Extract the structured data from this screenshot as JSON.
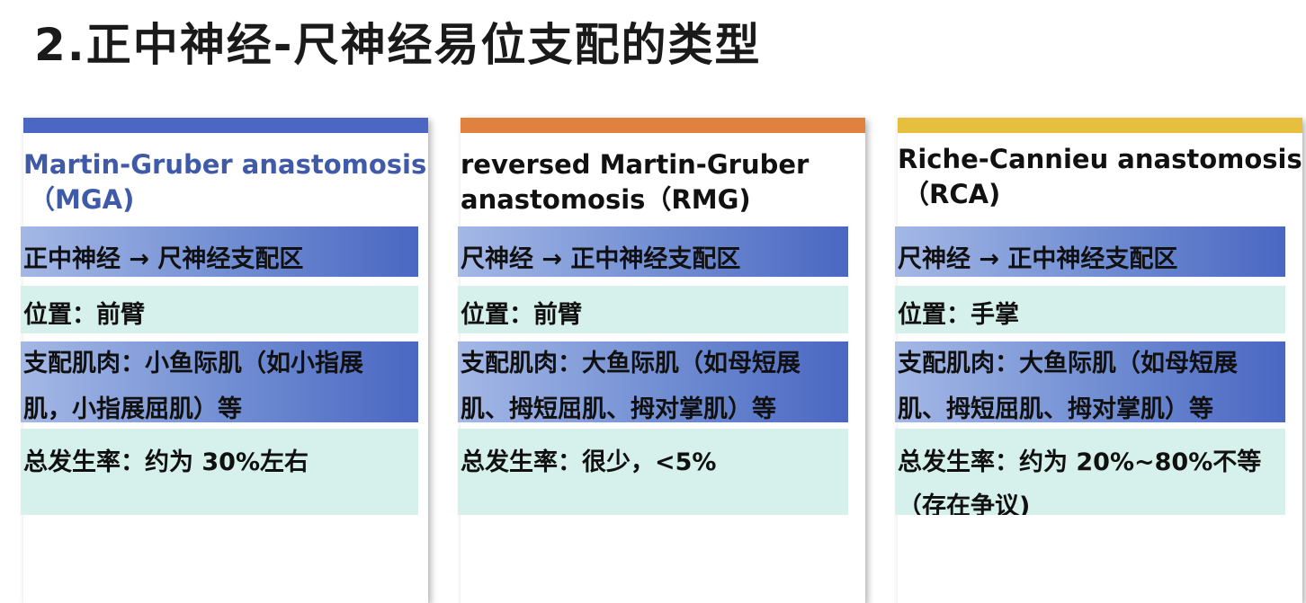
{
  "slide": {
    "title": "2.正中神经-尺神经易位支配的类型"
  },
  "cards": [
    {
      "bar_color": "#4b66c3",
      "title_color": "#3f5aa8",
      "title_lines": [
        "Martin-Gruber anastomosis",
        "（MGA)"
      ],
      "direction": "正中神经 → 尺神经支配区",
      "location": "位置：前臂",
      "muscles_lines": [
        "支配肌肉：小鱼际肌（如小指展",
        "肌，小指展屈肌）等"
      ],
      "incidence_lines": [
        "总发生率：约为 30%左右"
      ]
    },
    {
      "bar_color": "#e0813f",
      "title_color": "#111111",
      "title_lines": [
        "reversed Martin-Gruber",
        "anastomosis（RMG)"
      ],
      "direction": "尺神经 → 正中神经支配区",
      "location": "位置：前臂",
      "muscles_lines": [
        "支配肌肉：大鱼际肌（如母短展",
        "肌、拇短屈肌、拇对掌肌）等"
      ],
      "incidence_lines": [
        "总发生率：很少，<5%"
      ]
    },
    {
      "bar_color": "#e6bf3e",
      "title_color": "#111111",
      "title_lines": [
        "Riche-Cannieu anastomosis",
        "（RCA)"
      ],
      "direction": "尺神经 → 正中神经支配区",
      "location": "位置：手掌",
      "muscles_lines": [
        "支配肌肉：大鱼际肌（如母短展",
        "肌、拇短屈肌、拇对掌肌）等"
      ],
      "incidence_lines": [
        "总发生率：约为 20%~80%不等",
        "（存在争议)"
      ]
    }
  ]
}
